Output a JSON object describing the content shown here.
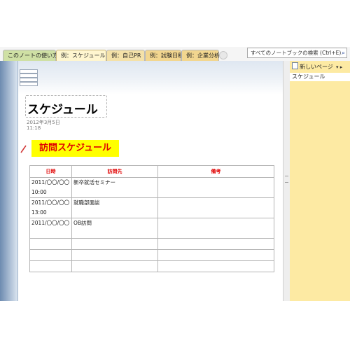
{
  "tabs": [
    {
      "label": "このノートの使い方"
    },
    {
      "label": "例：スケジュール"
    },
    {
      "label": "例：自己PR"
    },
    {
      "label": "例：試験日程"
    },
    {
      "label": "例：企業分析"
    }
  ],
  "search": {
    "placeholder": "すべてのノートブックの検索 (Ctrl+E)"
  },
  "page": {
    "title": "スケジュール",
    "date": "2012年3月5日",
    "time": "11:18",
    "heading": "訪問スケジュール"
  },
  "table": {
    "headers": [
      "日時",
      "訪問先",
      "備考"
    ],
    "rows": [
      {
        "date_line1": "2011/〇〇/〇〇",
        "date_line2": "10:00",
        "place": "新卒就活セミナー",
        "note": ""
      },
      {
        "date_line1": "2011/〇〇/〇〇",
        "date_line2": "13:00",
        "place": "就職部面談",
        "note": ""
      },
      {
        "date_line1": "2011/〇〇/〇〇",
        "date_line2": "",
        "place": "OB訪問",
        "note": ""
      }
    ]
  },
  "sidebar": {
    "new_page_label": "新しいページ",
    "pages": [
      {
        "label": "スケジュール"
      }
    ]
  }
}
